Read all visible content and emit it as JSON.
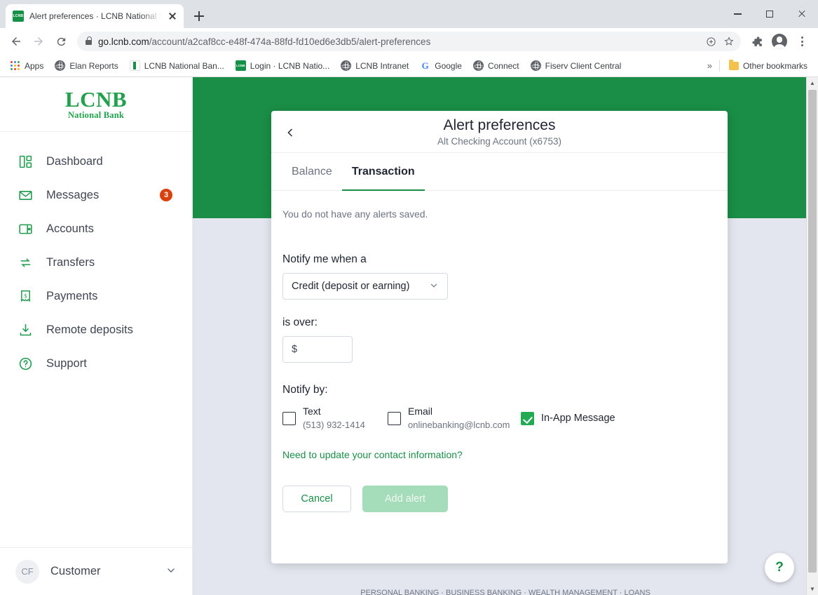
{
  "browser": {
    "tab": {
      "title": "Alert preferences · LCNB National Bank",
      "favicon_text": "LCNB",
      "close_icon": "close-icon",
      "new_tab_icon": "plus-icon"
    },
    "window_controls": {
      "minimize": "minimize-icon",
      "maximize": "maximize-icon",
      "close": "close-icon"
    },
    "nav": {
      "back": "back-arrow-icon",
      "forward": "forward-arrow-icon",
      "reload": "reload-icon"
    },
    "omnibox": {
      "lock_icon": "lock-icon",
      "host": "go.lcnb.com",
      "path": "/account/a2caf8cc-e48f-474a-88fd-fd10ed6e3db5/alert-preferences",
      "install_icon": "install-app-icon",
      "bookmark_icon": "star-icon"
    },
    "toolbar_right": {
      "extensions": "puzzle-piece-icon",
      "profile": "profile-avatar-icon",
      "menu": "three-dot-menu-icon"
    },
    "bookmarks": [
      {
        "label": "Apps",
        "icon": "apps-grid-icon"
      },
      {
        "label": "Elan Reports",
        "icon": "globe-icon"
      },
      {
        "label": "LCNB National Ban...",
        "icon": "lcnb-green-bar-icon"
      },
      {
        "label": "Login · LCNB Natio...",
        "icon": "lcnb-square-icon"
      },
      {
        "label": "LCNB Intranet",
        "icon": "globe-icon"
      },
      {
        "label": "Google",
        "icon": "google-g-icon"
      },
      {
        "label": "Connect",
        "icon": "globe-icon"
      },
      {
        "label": "Fiserv Client Central",
        "icon": "globe-icon"
      }
    ],
    "bookmarks_overflow": "»",
    "other_bookmarks": {
      "label": "Other bookmarks",
      "icon": "folder-icon"
    }
  },
  "sidebar": {
    "logo": {
      "line1": "LCNB",
      "line2": "National Bank"
    },
    "items": [
      {
        "label": "Dashboard",
        "icon": "dashboard-icon"
      },
      {
        "label": "Messages",
        "icon": "envelope-icon",
        "badge": "3"
      },
      {
        "label": "Accounts",
        "icon": "wallet-icon"
      },
      {
        "label": "Transfers",
        "icon": "transfer-arrows-icon"
      },
      {
        "label": "Payments",
        "icon": "receipt-dollar-icon"
      },
      {
        "label": "Remote deposits",
        "icon": "download-icon"
      },
      {
        "label": "Support",
        "icon": "question-circle-icon"
      }
    ],
    "user": {
      "initials": "CF",
      "name": "Customer",
      "chevron": "chevron-down-icon"
    }
  },
  "modal": {
    "back_icon": "back-chevron-icon",
    "title": "Alert preferences",
    "subtitle": "Alt Checking Account (x6753)",
    "tabs": [
      {
        "label": "Balance",
        "active": false
      },
      {
        "label": "Transaction",
        "active": true
      }
    ],
    "saved_note": "You do not have any alerts saved.",
    "notify_when_label": "Notify me when a",
    "transaction_type": {
      "value": "Credit (deposit or earning)",
      "chevron": "chevron-down-icon"
    },
    "is_over_label": "is over:",
    "amount": {
      "value": "",
      "prefix": "$",
      "placeholder": "$"
    },
    "notify_by_label": "Notify by:",
    "notify_channels": [
      {
        "id": "text",
        "label": "Text",
        "detail": "(513) 932-1414",
        "checked": false
      },
      {
        "id": "email",
        "label": "Email",
        "detail": "onlinebanking@lcnb.com",
        "checked": false
      },
      {
        "id": "in-app",
        "label": "In-App Message",
        "detail": "",
        "checked": true
      }
    ],
    "update_contact_link": "Need to update your contact information?",
    "cancel_label": "Cancel",
    "add_label": "Add alert"
  },
  "help_fab": {
    "glyph": "?",
    "name": "help-button"
  },
  "footer_ghost": "PERSONAL BANKING  ·  BUSINESS BANKING  ·  WEALTH MANAGEMENT  ·  LOANS",
  "colors": {
    "brand_green": "#1a8d46",
    "logo_green": "#21a14b",
    "check_green": "#22ab53",
    "badge_red": "#d9400c",
    "page_bg": "#e3e6ee",
    "disabled_green": "#a5dcb9"
  }
}
